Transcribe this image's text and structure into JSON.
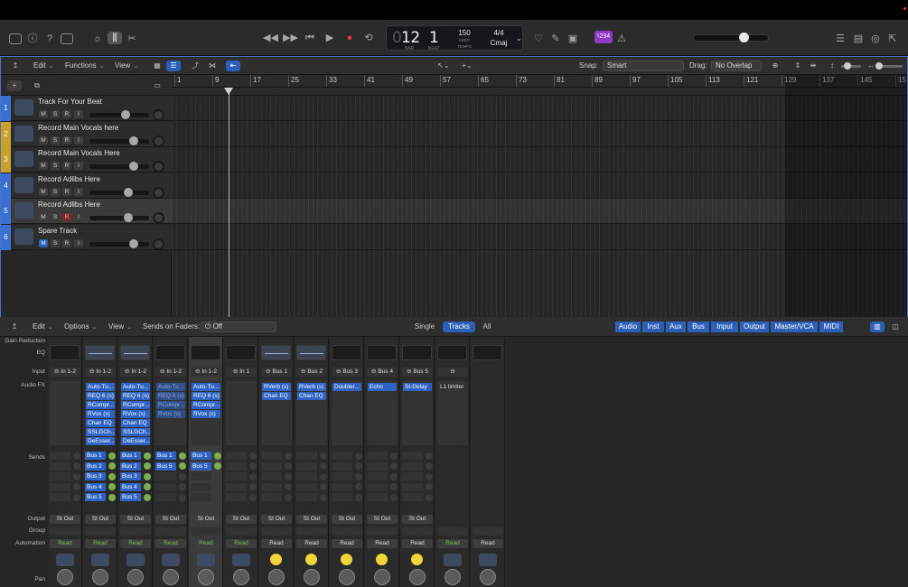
{
  "transport": {
    "lcd_bar": "12",
    "lcd_beat": "1",
    "lcd_bar_label": "BAR",
    "lcd_beat_label": "BEAT",
    "tempo": "150",
    "keep_label": "KEEP",
    "tempo_label": "TEMPO",
    "signature": "4/4",
    "key": "Cmaj",
    "badge": "♮234"
  },
  "arrange": {
    "menus": [
      "Edit",
      "Functions",
      "View"
    ],
    "snap_label": "Snap:",
    "snap_value": "Smart",
    "drag_label": "Drag:",
    "drag_value": "No Overlap",
    "ruler": [
      "1",
      "9",
      "17",
      "25",
      "33",
      "41",
      "49",
      "57",
      "65",
      "73",
      "81",
      "89",
      "97",
      "105",
      "113",
      "121",
      "129",
      "137",
      "145",
      "15"
    ],
    "tracks": [
      {
        "num": "1",
        "name": "Track For Your Beat",
        "color": "#3b6fd1",
        "mute_on": false,
        "rec": false,
        "vol": 0.62
      },
      {
        "num": "2",
        "name": "Record Main Vocals here",
        "color": "#c9a227",
        "mute_on": false,
        "rec": false,
        "vol": 0.78
      },
      {
        "num": "3",
        "name": "Record Main Vocals Here",
        "color": "#c9a227",
        "mute_on": false,
        "rec": false,
        "vol": 0.78
      },
      {
        "num": "4",
        "name": "Record Adlibs Here",
        "color": "#3b6fd1",
        "mute_on": false,
        "rec": false,
        "vol": 0.68
      },
      {
        "num": "5",
        "name": "Record Adlibs Here",
        "color": "#3b6fd1",
        "mute_on": false,
        "rec": true,
        "vol": 0.68
      },
      {
        "num": "6",
        "name": "Spare Track",
        "color": "#3b6fd1",
        "mute_on": true,
        "rec": false,
        "vol": 0.78
      }
    ],
    "btn_m": "M",
    "btn_s": "S",
    "btn_r": "R",
    "btn_i": "I"
  },
  "mixer": {
    "menus": [
      "Edit",
      "Options",
      "View"
    ],
    "sends_on_faders_label": "Sends on Faders:",
    "sends_on_faders_value": "Off",
    "view_modes": [
      "Single",
      "Tracks",
      "All"
    ],
    "filters": [
      "Audio",
      "Inst",
      "Aux",
      "Bus",
      "Input",
      "Output",
      "Master/VCA",
      "MIDI"
    ],
    "row_labels": {
      "gain": "Gain Reduction",
      "eq": "EQ",
      "input": "Input",
      "fx": "Audio FX",
      "sends": "Sends",
      "output": "Output",
      "group": "Group",
      "automation": "Automation",
      "pan": "Pan"
    },
    "strips": [
      {
        "input": "In 1-2",
        "eq": false,
        "fx": [],
        "sends": [],
        "output": "St Out",
        "auto": "Read",
        "auto_green": true,
        "icon": "wave",
        "sel": false
      },
      {
        "input": "In 1-2",
        "eq": true,
        "fx": [
          {
            "n": "Auto-Tu..."
          },
          {
            "n": "REQ 6 (s)"
          },
          {
            "n": "RCompr..."
          },
          {
            "n": "RVox (s)"
          },
          {
            "n": "Chan EQ"
          },
          {
            "n": "SSLGCh..."
          },
          {
            "n": "DeEsser..."
          }
        ],
        "sends": [
          "Bus 1",
          "Bus 2",
          "Bus 3",
          "Bus 4",
          "Bus 5"
        ],
        "output": "St Out",
        "auto": "Read",
        "auto_green": true,
        "icon": "wave",
        "sel": false
      },
      {
        "input": "In 1-2",
        "eq": true,
        "fx": [
          {
            "n": "Auto-Tu..."
          },
          {
            "n": "REQ 6 (s)"
          },
          {
            "n": "RCompr..."
          },
          {
            "n": "RVox (s)"
          },
          {
            "n": "Chan EQ"
          },
          {
            "n": "SSLGCh..."
          },
          {
            "n": "DeEsser..."
          }
        ],
        "sends": [
          "Bus 1",
          "Bus 2",
          "Bus 3",
          "Bus 4",
          "Bus 5"
        ],
        "output": "St Out",
        "auto": "Read",
        "auto_green": true,
        "icon": "wave",
        "sel": false
      },
      {
        "input": "In 1-2",
        "eq": false,
        "fx": [
          {
            "n": "Auto-Tu...",
            "off": true
          },
          {
            "n": "REQ 6 (s)",
            "off": true
          },
          {
            "n": "RCompr...",
            "off": true
          },
          {
            "n": "RVox (s)",
            "off": true
          }
        ],
        "sends": [
          "Bus 1",
          "Bus 5"
        ],
        "output": "St Out",
        "auto": "Read",
        "auto_green": true,
        "icon": "wave",
        "sel": false
      },
      {
        "input": "In 1-2",
        "eq": false,
        "fx": [
          {
            "n": "Auto-Tu..."
          },
          {
            "n": "REQ 6 (s)"
          },
          {
            "n": "RCompr..."
          },
          {
            "n": "RVox (s)"
          }
        ],
        "sends": [
          "Bus 1",
          "Bus 5"
        ],
        "output": "St Out",
        "auto": "Read",
        "auto_green": true,
        "icon": "wave",
        "sel": true
      },
      {
        "input": "In 1",
        "eq": false,
        "fx": [],
        "sends": [],
        "output": "St Out",
        "auto": "Read",
        "auto_green": true,
        "icon": "wave",
        "sel": false
      },
      {
        "input": "Bus 1",
        "eq": true,
        "fx": [
          {
            "n": "RVerb (s)"
          },
          {
            "n": "Chan EQ"
          }
        ],
        "sends": [],
        "output": "St Out",
        "auto": "Read",
        "auto_green": false,
        "icon": "knob",
        "sel": false
      },
      {
        "input": "Bus 2",
        "eq": true,
        "fx": [
          {
            "n": "RVerb (s)"
          },
          {
            "n": "Chan EQ"
          }
        ],
        "sends": [],
        "output": "St Out",
        "auto": "Read",
        "auto_green": false,
        "icon": "knob",
        "sel": false
      },
      {
        "input": "Bus 3",
        "eq": false,
        "fx": [
          {
            "n": "Doubler..."
          }
        ],
        "sends": [],
        "output": "St Out",
        "auto": "Read",
        "auto_green": false,
        "icon": "knob",
        "sel": false
      },
      {
        "input": "Bus 4",
        "eq": false,
        "fx": [
          {
            "n": "Echo"
          }
        ],
        "sends": [],
        "output": "St Out",
        "auto": "Read",
        "auto_green": false,
        "icon": "knob",
        "sel": false
      },
      {
        "input": "Bus 5",
        "eq": false,
        "fx": [
          {
            "n": "St-Delay"
          }
        ],
        "sends": [],
        "output": "St Out",
        "auto": "Read",
        "auto_green": false,
        "icon": "knob",
        "sel": false
      },
      {
        "input": "",
        "eq": false,
        "fx": [
          {
            "n": "L1 limiter",
            "plain": true
          }
        ],
        "sends": [],
        "output": "",
        "auto": "Read",
        "auto_green": true,
        "icon": "wave",
        "sel": false
      },
      {
        "input": "",
        "eq": false,
        "fx": [],
        "sends": [],
        "output": "",
        "auto": "Read",
        "auto_green": false,
        "icon": "wave",
        "sel": false
      }
    ]
  }
}
